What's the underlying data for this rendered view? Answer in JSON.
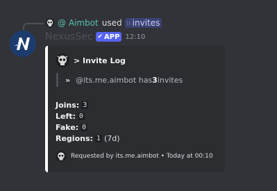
{
  "reply": {
    "user": "@ Aimbot",
    "verb": "used",
    "command": "invites",
    "command_icon": "slash-command-icon"
  },
  "message": {
    "author": "NexusSec",
    "badge": "APP",
    "badge_icon": "check-icon",
    "time": "12:10",
    "avatar_icon": "nexus-logo-icon"
  },
  "embed": {
    "accent_color": "#ffffff",
    "author_icon": "skull-icon",
    "title": "> Invite Log",
    "quote": {
      "arrow": "»",
      "prefix": "@its.me.aimbot has ",
      "count": "3",
      "suffix": " invites"
    },
    "stats": [
      {
        "label": "Joins:",
        "value": "3",
        "extra": ""
      },
      {
        "label": "Left:",
        "value": "0",
        "extra": ""
      },
      {
        "label": "Fake:",
        "value": "0",
        "extra": ""
      },
      {
        "label": "Regions:",
        "value": "1",
        "extra": "(7d)"
      }
    ],
    "footer": "Requested by its.me.aimbot • Today at 00:10"
  },
  "colors": {
    "background": "#313338",
    "embed_background": "#2b2d31",
    "app_badge": "#5865f2",
    "reply_user": "#5bc0b0",
    "command_chip": "#3c4270"
  }
}
